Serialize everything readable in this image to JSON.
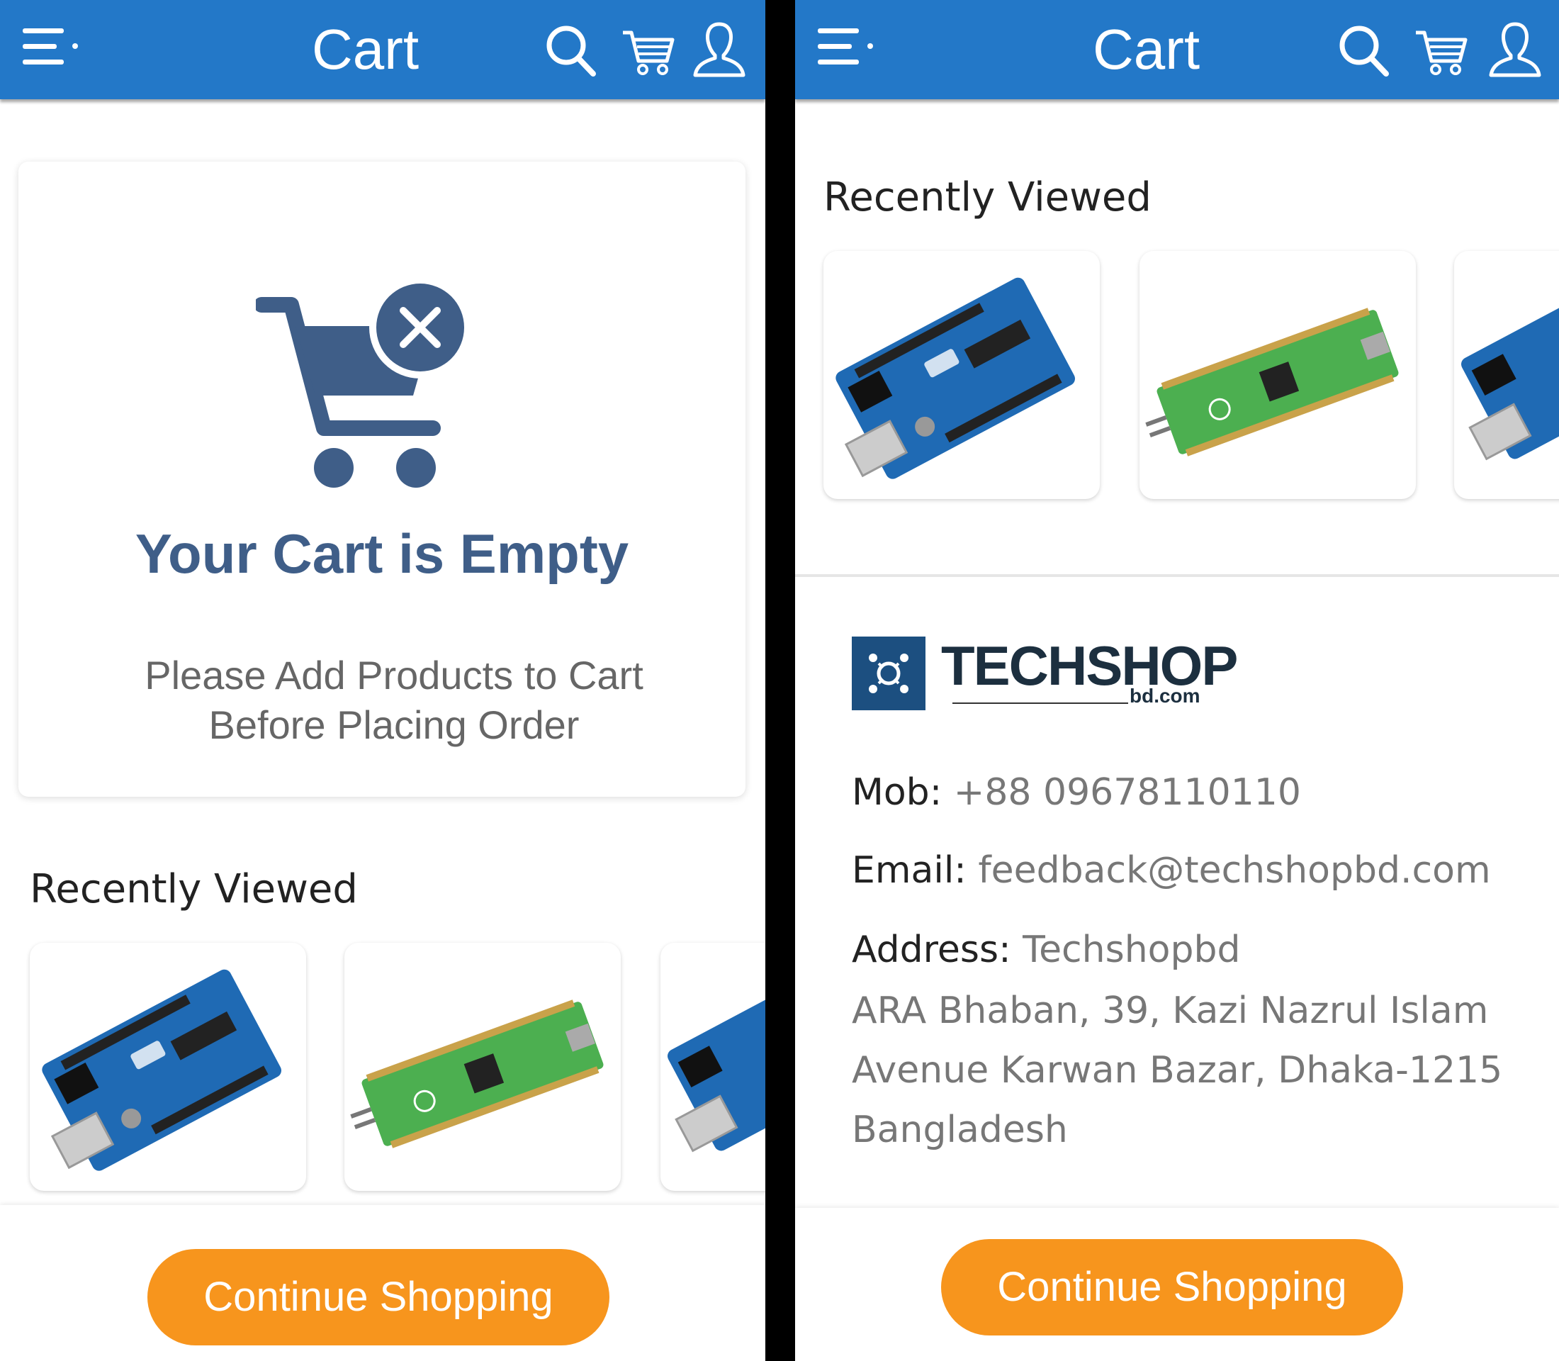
{
  "header": {
    "title": "Cart"
  },
  "empty_cart": {
    "title": "Your Cart is Empty",
    "message_line1": "Please Add Products to Cart",
    "message_line2": "Before Placing Order"
  },
  "recently_viewed": {
    "title": "Recently Viewed"
  },
  "buttons": {
    "continue_shopping": "Continue Shopping"
  },
  "store": {
    "logo_text": "TECHSHOP",
    "logo_domain": "bd.com",
    "mob_label": "Mob:",
    "mob_value": "+88 09678110110",
    "email_label": "Email:",
    "email_value": "feedback@techshopbd.com",
    "address_label": "Address:",
    "address_line1": "Techshopbd",
    "address_line2": "ARA Bhaban, 39, Kazi Nazrul Islam",
    "address_line3": "Avenue Karwan Bazar, Dhaka-1215",
    "address_line4": "Bangladesh"
  },
  "colors": {
    "header_blue": "#2378c8",
    "button_orange": "#f7951d",
    "empty_title": "#3f5e88"
  }
}
